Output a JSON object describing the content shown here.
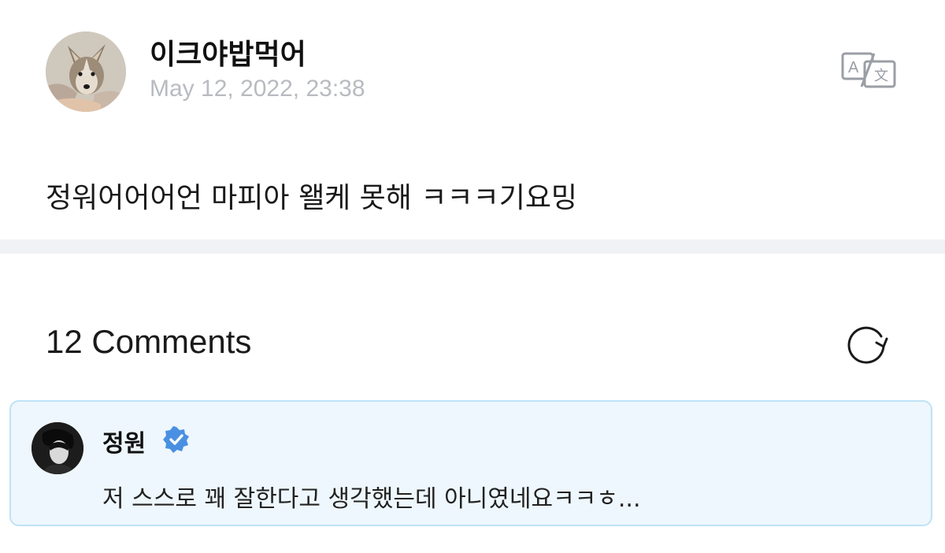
{
  "post": {
    "author": "이크야밥먹어",
    "timestamp": "May 12, 2022, 23:38",
    "body": "정워어어어언 마피아 왤케 못해 ㅋㅋㅋ기요밍",
    "avatar_icon": "dog-avatar-icon",
    "translate_icon": "translate-icon"
  },
  "comments": {
    "title": "12 Comments",
    "refresh_icon": "refresh-icon",
    "items": [
      {
        "author": "정원",
        "verified": true,
        "verified_color": "#4a90e2",
        "text": "저 스스로 꽤 잘한다고 생각했는데 아니였네요ㅋㅋㅎ...",
        "highlight_bg": "#eef7fd",
        "highlight_border": "#bfe2f6"
      }
    ]
  },
  "colors": {
    "timestamp": "#b8bbc0",
    "divider": "#f1f2f5",
    "text": "#1a1a1a"
  }
}
